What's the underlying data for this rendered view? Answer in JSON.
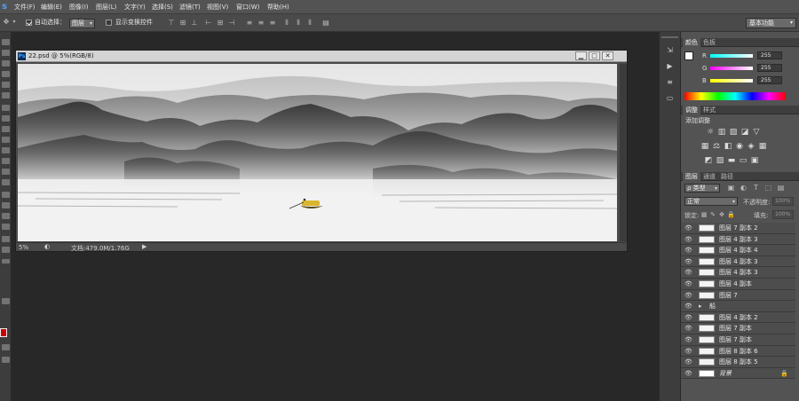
{
  "menubar": {
    "logo": "s",
    "items": [
      "文件(F)",
      "编辑(E)",
      "图像(I)",
      "图层(L)",
      "文字(Y)",
      "选择(S)",
      "滤镜(T)",
      "视图(V)",
      "窗口(W)",
      "帮助(H)"
    ]
  },
  "options": {
    "auto_select_label": "自动选择：",
    "auto_select_value": "图层",
    "show_transform_label": "显示变换控件",
    "workspace": "基本功能"
  },
  "document": {
    "title": "22.psd @ 5%(RGB/8)",
    "zoom": "5%",
    "doc_info": "文档:479.0M/1.76G"
  },
  "color_panel": {
    "tabs": [
      "颜色",
      "色板"
    ],
    "r_label": "R",
    "g_label": "G",
    "b_label": "B",
    "r": "255",
    "g": "255",
    "b": "255",
    "fg_color": "#ffffff",
    "bg_color": "#cc0000"
  },
  "adjust_panel": {
    "tabs": [
      "调整",
      "样式"
    ],
    "add_label": "添加调整"
  },
  "layers_panel": {
    "tabs": [
      "图层",
      "通道",
      "路径"
    ],
    "filter_kind": "ρ 类型",
    "blend_mode": "正常",
    "opacity_label": "不透明度:",
    "opacity": "100%",
    "lock_label": "锁定:",
    "fill_label": "填充:",
    "fill": "100%",
    "layers": [
      {
        "name": "图层 7 副本 2"
      },
      {
        "name": "图层 4 副本 3"
      },
      {
        "name": "图层 4 副本 4"
      },
      {
        "name": "图层 4 副本 3"
      },
      {
        "name": "图层 4 副本 3"
      },
      {
        "name": "图层 4 副本"
      },
      {
        "name": "图层 7"
      },
      {
        "name": "船"
      },
      {
        "name": "图层 4 副本 2"
      },
      {
        "name": "图层 7 副本"
      },
      {
        "name": "图层 7 副本"
      },
      {
        "name": "图层 8 副本 6"
      },
      {
        "name": "图层 8 副本 5"
      },
      {
        "name": "背景"
      }
    ]
  }
}
